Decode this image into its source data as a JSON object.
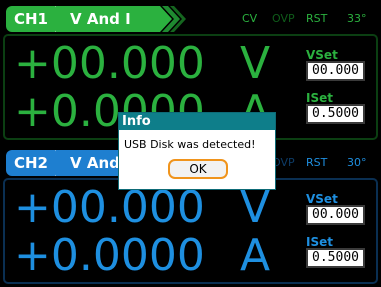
{
  "channels": [
    {
      "tab_label": "CH1",
      "mode_label": "V And I",
      "status_cv": "CV",
      "status_ovp": "OVP",
      "status_rst": "RST",
      "status_temp": "33°",
      "voltage_reading": "+00.000",
      "voltage_unit": "V",
      "current_reading": "+0.0000",
      "current_unit": "A",
      "vset_label": "VSet",
      "vset_value": "00.000",
      "iset_label": "ISet",
      "iset_value": "0.5000",
      "color": "#2bb13f"
    },
    {
      "tab_label": "CH2",
      "mode_label": "V And I",
      "status_cv": "CV",
      "status_ovp": "OVP",
      "status_rst": "RST",
      "status_temp": "30°",
      "voltage_reading": "+00.000",
      "voltage_unit": "V",
      "current_reading": "+0.0000",
      "current_unit": "A",
      "vset_label": "VSet",
      "vset_value": "00.000",
      "iset_label": "ISet",
      "iset_value": "0.5000",
      "color": "#1e8fe0"
    }
  ],
  "dialog": {
    "title": "Info",
    "message": "USB Disk was detected!",
    "ok_label": "OK",
    "title_color": "#0e7e8a",
    "button_border_color": "#f0941c"
  }
}
